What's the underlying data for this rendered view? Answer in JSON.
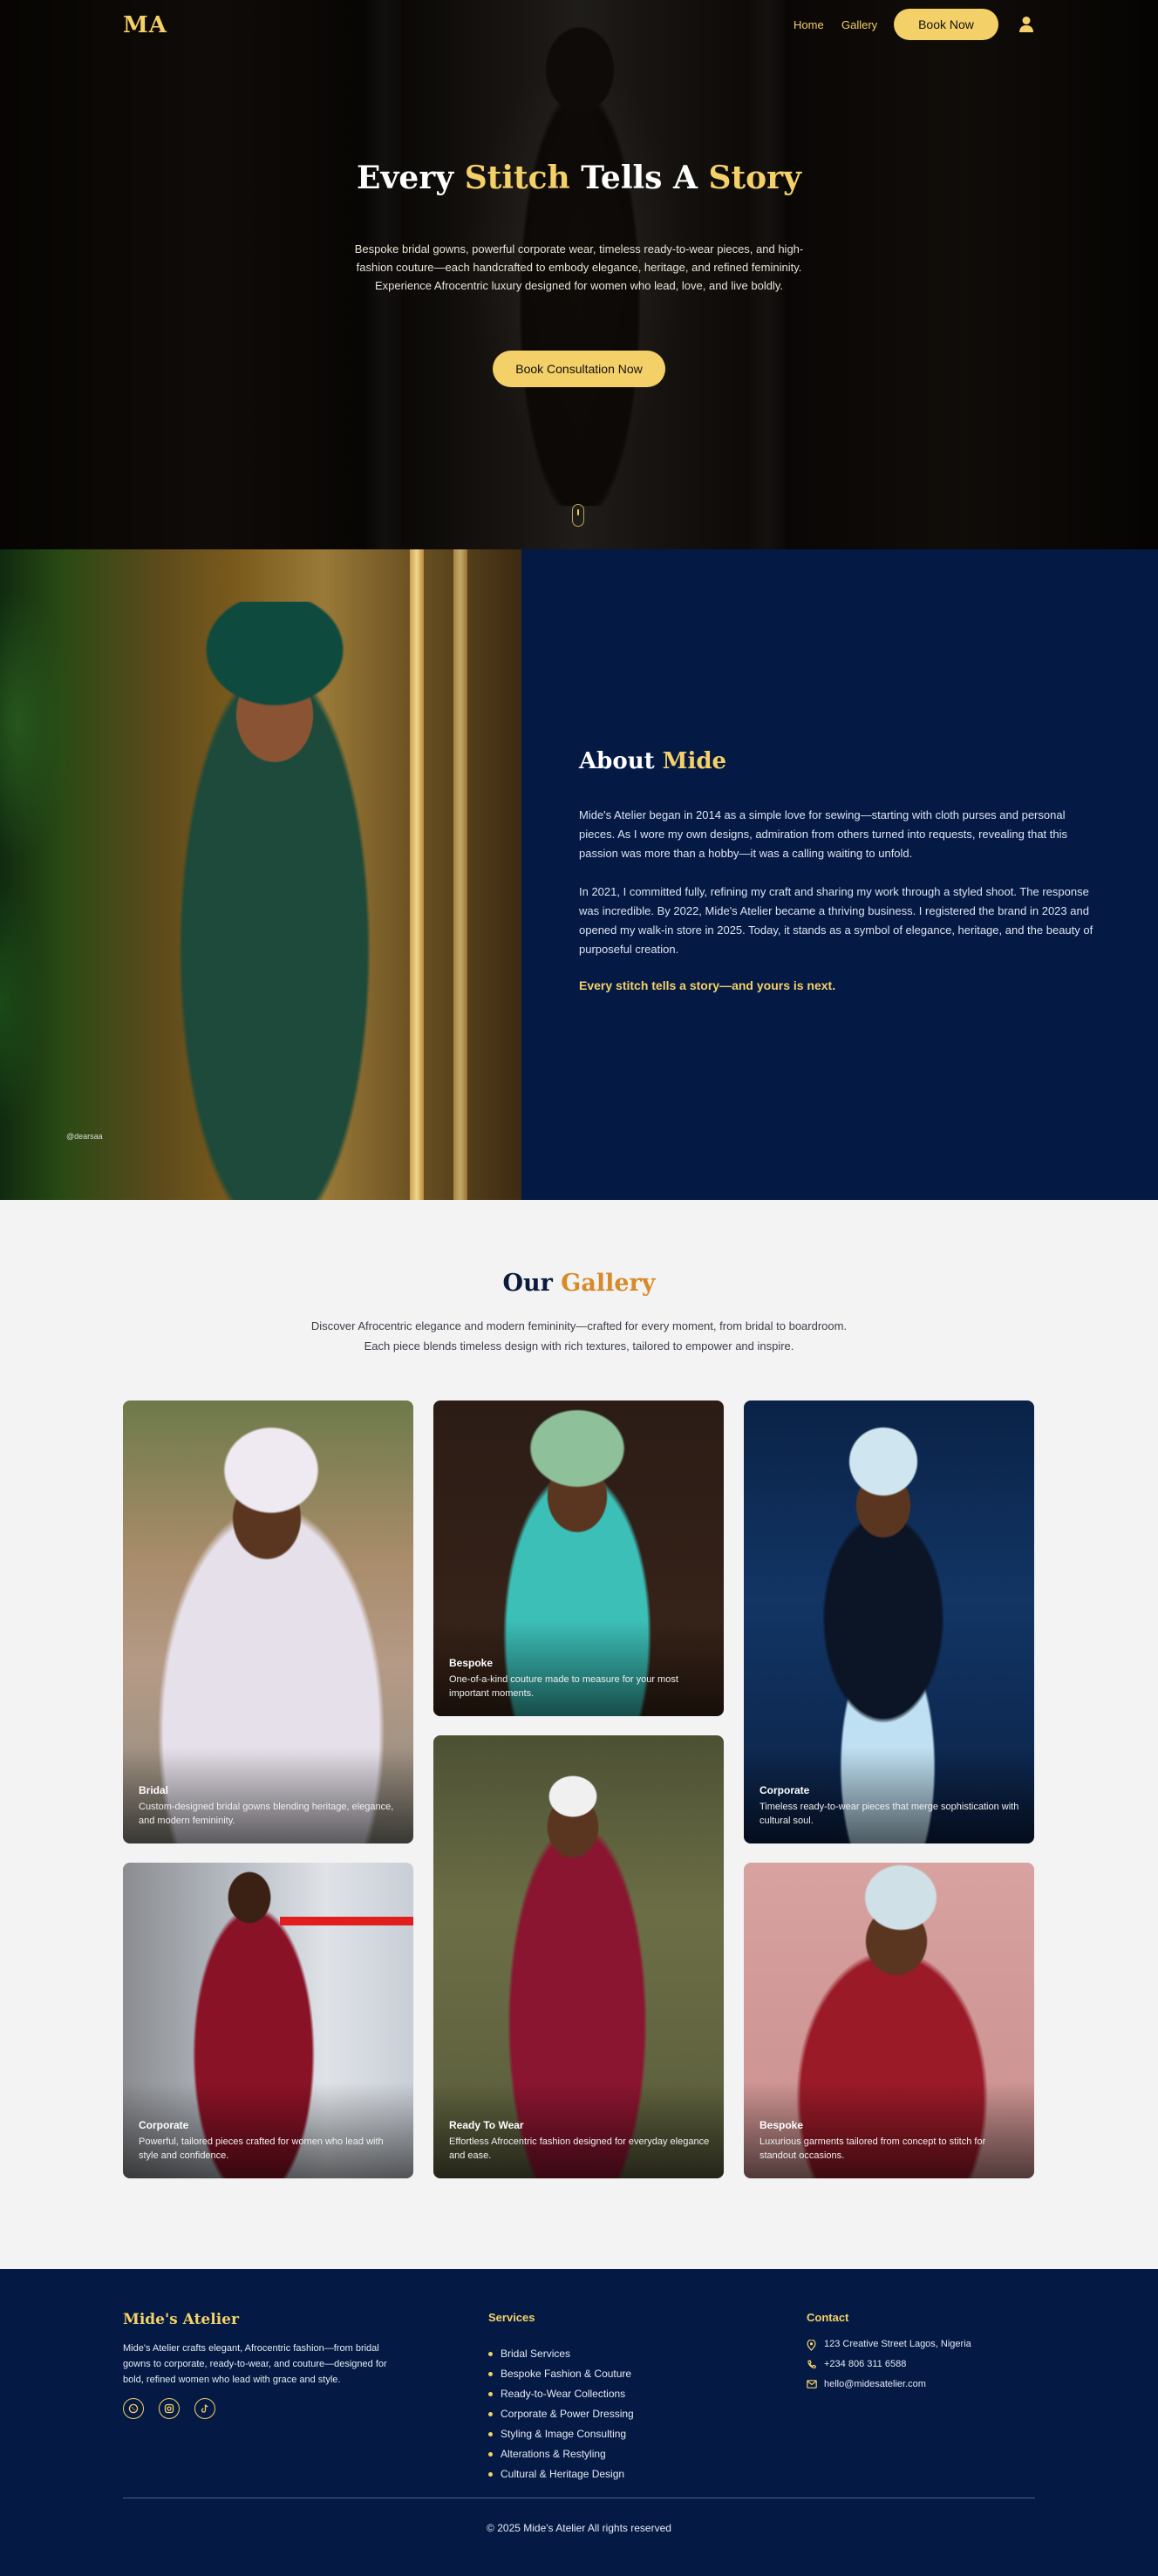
{
  "nav": {
    "logo": "MA",
    "home": "Home",
    "gallery": "Gallery",
    "book_now": "Book Now",
    "user_icon": "user-icon"
  },
  "hero": {
    "title_1": "Every ",
    "title_2": "Stitch",
    "title_3": " Tells A ",
    "title_4": "Story",
    "description": "Bespoke bridal gowns, powerful corporate wear, timeless ready-to-wear pieces, and high-fashion couture—each handcrafted to embody elegance, heritage, and refined femininity. Experience Afrocentric luxury designed for women who lead, love, and live boldly.",
    "cta": "Book Consultation Now"
  },
  "about": {
    "title_1": "About ",
    "title_2": "Mide",
    "photo_credit": "@dearsaa",
    "paragraph_1": "Mide's Atelier began in 2014 as a simple love for sewing—starting with cloth purses and personal pieces. As I wore my own designs, admiration from others turned into requests, revealing that this passion was more than a hobby—it was a calling waiting to unfold.",
    "paragraph_2": "In 2021, I committed fully, refining my craft and sharing my work through a styled shoot. The response was incredible. By 2022, Mide's Atelier became a thriving business. I registered the brand in 2023 and opened my walk-in store in 2025. Today, it stands as a symbol of elegance, heritage, and the beauty of purposeful creation.",
    "tagline": "Every stitch tells a story—and yours is next."
  },
  "gallery": {
    "title_1": "Our ",
    "title_2": "Gallery",
    "desc_line_1": "Discover Afrocentric elegance and modern femininity—crafted for every moment, from bridal to boardroom.",
    "desc_line_2": "Each piece blends timeless design with rich textures, tailored to empower and inspire.",
    "cards": [
      {
        "title": "Bridal",
        "desc": "Custom-designed bridal gowns blending heritage, elegance, and modern femininity."
      },
      {
        "title": "Bespoke",
        "desc": "One-of-a-kind couture made to measure for your most important moments."
      },
      {
        "title": "Corporate",
        "desc": "Timeless ready-to-wear pieces that merge sophistication with cultural soul."
      },
      {
        "title": "Corporate",
        "desc": "Powerful, tailored pieces crafted for women who lead with style and confidence."
      },
      {
        "title": "Ready To Wear",
        "desc": "Effortless Afrocentric fashion designed for everyday elegance and ease."
      },
      {
        "title": "Bespoke",
        "desc": "Luxurious garments tailored from concept to stitch for standout occasions."
      }
    ]
  },
  "footer": {
    "brand": "Mide's Atelier",
    "about": "Mide's Atelier crafts elegant, Afrocentric fashion—from bridal gowns to corporate, ready-to-wear, and couture—designed for bold, refined women who lead with grace and style.",
    "social_icons": [
      "whatsapp-icon",
      "instagram-icon",
      "tiktok-icon"
    ],
    "services_title": "Services",
    "services": [
      "Bridal Services",
      "Bespoke Fashion & Couture",
      "Ready-to-Wear Collections",
      "Corporate & Power Dressing",
      "Styling & Image Consulting",
      "Alterations & Restyling",
      "Cultural & Heritage Design"
    ],
    "contact_title": "Contact",
    "address": "123 Creative Street Lagos, Nigeria",
    "phone": "+234 806 311 6588",
    "email": "hello@midesatelier.com",
    "copyright": "© 2025 Mide's Atelier All rights reserved"
  },
  "colors": {
    "gold": "#f4d068",
    "navy": "#041a44",
    "gallery_accent": "#d78a2a"
  }
}
